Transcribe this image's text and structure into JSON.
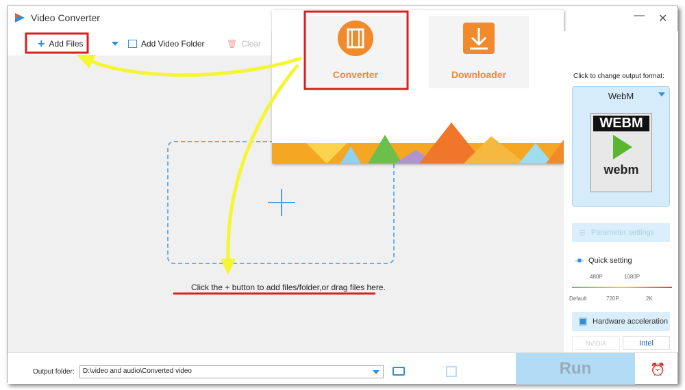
{
  "window": {
    "title": "Video Converter",
    "minimize": "—",
    "close": "✕"
  },
  "toolbar": {
    "add_files": "Add Files",
    "add_folder": "Add Video Folder",
    "clear": "Clear"
  },
  "popup": {
    "modules": [
      {
        "label": "Converter",
        "icon": "film-icon"
      },
      {
        "label": "Downloader",
        "icon": "download-icon"
      }
    ]
  },
  "main": {
    "hint": "Click the + button to add files/folder,or drag files here."
  },
  "right": {
    "prompt": "Click to change output format:",
    "format": "WebM",
    "format_logo_top": "WEBM",
    "format_logo_bottom": "webm",
    "param_settings": "Parameter settings",
    "quick_setting": "Quick setting",
    "quality_top": [
      "480P",
      "1080P"
    ],
    "quality_bottom": [
      "Default",
      "720P",
      "2K"
    ],
    "hw_accel": "Hardware acceleration",
    "nvidia": "NVIDIA",
    "intel": "Intel"
  },
  "bottom": {
    "output_label": "Output folder:",
    "output_path": "D:\\video and audio\\Converted video",
    "run": "Run"
  },
  "colors": {
    "accent": "#2f8fdc",
    "orange": "#f08a2a",
    "annotation_red": "#d81e1e",
    "annotation_yellow": "#f5f532"
  }
}
